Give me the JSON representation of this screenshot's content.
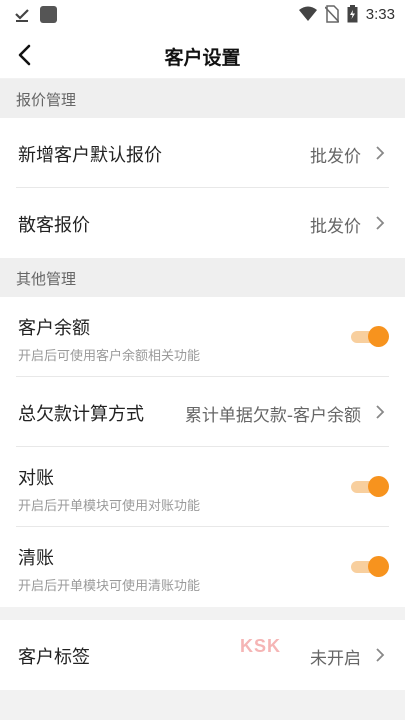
{
  "status_bar": {
    "time": "3:33",
    "icons": [
      "check-icon",
      "square-app-icon",
      "wifi-icon",
      "no-sim-icon",
      "battery-icon"
    ]
  },
  "nav": {
    "title": "客户设置",
    "back_icon": "back-arrow-icon"
  },
  "sections": {
    "quote": {
      "header": "报价管理",
      "new_customer_quote": {
        "label": "新增客户默认报价",
        "value": "批发价"
      },
      "walk_in_quote": {
        "label": "散客报价",
        "value": "批发价"
      }
    },
    "other": {
      "header": "其他管理",
      "customer_balance": {
        "label": "客户余额",
        "desc": "开启后可使用客户余额相关功能",
        "enabled": true
      },
      "total_debt_method": {
        "label": "总欠款计算方式",
        "value": "累计单据欠款-客户余额"
      },
      "reconcile": {
        "label": "对账",
        "desc": "开启后开单模块可使用对账功能",
        "enabled": true
      },
      "clear_account": {
        "label": "清账",
        "desc": "开启后开单模块可使用清账功能",
        "enabled": true
      }
    },
    "tags": {
      "customer_tag": {
        "label": "客户标签",
        "value": "未开启"
      }
    }
  },
  "colors": {
    "accent": "#f7931e",
    "track": "#f8cf9e",
    "background": "#f2f2f2"
  }
}
